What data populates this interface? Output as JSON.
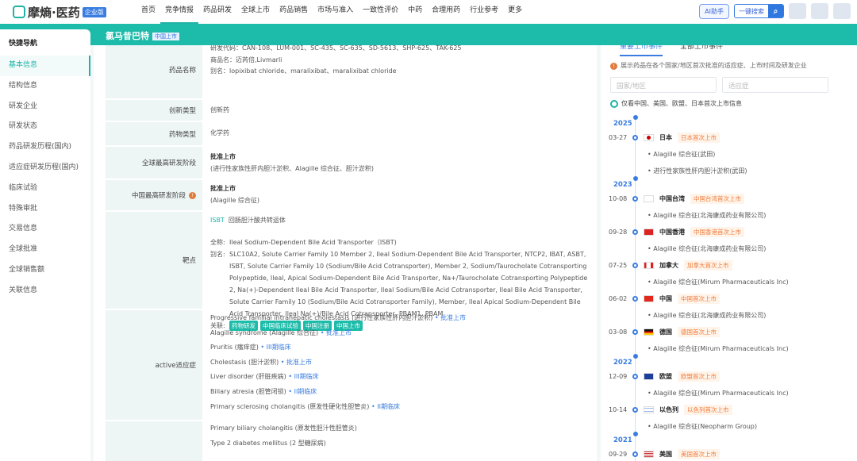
{
  "header": {
    "logo": "摩熵·医药",
    "edition": "企业版",
    "nav": [
      "首页",
      "竞争情报",
      "药品研发",
      "全球上市",
      "药品销售",
      "市场与准入",
      "一致性评价",
      "中药",
      "合理用药",
      "行业参考",
      "更多"
    ],
    "ai": "AI助手",
    "search": "一键搜索"
  },
  "drug": {
    "name": "氯马昔巴特",
    "tag": "中国上市"
  },
  "sidebar": {
    "title": "快捷导航",
    "items": [
      "基本信息",
      "结构信息",
      "研发企业",
      "研发状态",
      "药品研发历程(国内)",
      "适应症研发历程(国内)",
      "临床试验",
      "特殊审批",
      "交易信息",
      "全球批准",
      "全球销售额",
      "关联信息"
    ]
  },
  "info": {
    "name_label": "药品名称",
    "codes": "研发代码：CAN-108、LUM-001、SC-435、SC-635、SD-5613、SHP-625、TAK-625",
    "trade": "商品名：迈芮倍,Livmarli",
    "alias": "别名：lopixibat chloride、maralixibat、maralixibat chloride",
    "innov_label": "创新类型",
    "innov": "创新药",
    "type_label": "药物类型",
    "type": "化学药",
    "global_label": "全球最高研发阶段",
    "global_stage": "批准上市",
    "global_note": "(进行性家族性肝内胆汁淤积、Alagille 综合征、胆汁淤积)",
    "china_label": "中国最高研发阶段",
    "china_stage": "批准上市",
    "china_note": "(Alagille 综合征)",
    "target_label": "靶点",
    "target_code": "ISBT",
    "target_cn": "回肠胆汁酸共转运体",
    "full_label": "全称:",
    "full": "Ileal Sodium-Dependent Bile Acid Transporter（ISBT)",
    "alias_label": "别名:",
    "target_alias": "SLC10A2, Solute Carrier Family 10 Member 2, Ileal Sodium-Dependent Bile Acid Transporter, NTCP2, IBAT, ASBT, ISBT, Solute Carrier Family 10 (Sodium/Bile Acid Cotransporter), Member 2, Sodium/Taurocholate Cotransporting Polypeptide, Ileal, Apical Sodium-Dependent Bile Acid Transporter, Na+/Taurocholate Cotransporting Polypeptide 2, Na(+)-Dependent Ileal Bile Acid Transporter, Ileal Sodium/Bile Acid Cotransporter, Ileal Bile Acid Transporter, Solute Carrier Family 10 (Sodium/Bile Acid Cotransporter Family), Member, Ileal Apical Sodium-Dependent Bile Acid Transporter, Ileal Na(+)/Bile Acid Cotransporter, PBAM1, PBAM",
    "rel_label": "关联:",
    "rel": [
      "药物研发",
      "中国临床试验",
      "中国注册",
      "中国上市"
    ],
    "active_label": "active适应症",
    "active": [
      {
        "n": "Progressive familial intrahepatic cholestasis (进行性家族性肝内胆汁淤积)",
        "s": "• 批准上市"
      },
      {
        "n": "Alagille syndrome (Alagille 综合征)",
        "s": "• 批准上市"
      },
      {
        "n": "Pruritis (瘙痒症)",
        "s": "• III期临床"
      },
      {
        "n": "Cholestasis (胆汁淤积)",
        "s": "• 批准上市"
      },
      {
        "n": "Liver disorder (肝脏疾病)",
        "s": "• III期临床"
      },
      {
        "n": "Biliary atresia (胆管闭锁)",
        "s": "• II期临床"
      },
      {
        "n": "Primary sclerosing cholangitis (原发性硬化性胆管炎)",
        "s": "• II期临床"
      }
    ],
    "next": [
      "Primary biliary cholangitis (原发性胆汁性胆管炎)",
      "Type 2 diabetes mellitus (2 型糖尿病)"
    ]
  },
  "right": {
    "tabs": [
      "重要上市事件",
      "全部上市事件"
    ],
    "tip": "展示药品在各个国家/地区首次批准的适应症、上市时间及研发企业",
    "country_ph": "国家/地区",
    "ind_ph": "适应症",
    "filter": "仅看中国、美国、欧盟、日本首次上市信息",
    "timeline": [
      {
        "year": "2025",
        "events": [
          {
            "date": "03-27",
            "country": "日本",
            "tag": "日本首次上市",
            "flag": "jp",
            "items": [
              "Alagille 综合征(武田)",
              "进行性家族性肝内胆汁淤积(武田)"
            ]
          }
        ]
      },
      {
        "year": "2023",
        "events": [
          {
            "date": "10-08",
            "country": "中国台湾",
            "tag": "中国台湾首次上市",
            "flag": "tw",
            "items": [
              "Alagille 综合征(北海康成药业有限公司)"
            ]
          },
          {
            "date": "09-28",
            "country": "中国香港",
            "tag": "中国香港首次上市",
            "flag": "hk",
            "items": [
              "Alagille 综合征(北海康成药业有限公司)"
            ]
          },
          {
            "date": "07-25",
            "country": "加拿大",
            "tag": "加拿大首次上市",
            "flag": "ca",
            "items": [
              "Alagille 综合征(Mirum Pharmaceuticals Inc)"
            ]
          },
          {
            "date": "06-02",
            "country": "中国",
            "tag": "中国首次上市",
            "flag": "cn",
            "items": [
              "Alagille 综合征(北海康成药业有限公司)"
            ]
          },
          {
            "date": "03-08",
            "country": "德国",
            "tag": "德国首次上市",
            "flag": "de",
            "items": [
              "Alagille 综合征(Mirum Pharmaceuticals Inc)"
            ]
          }
        ]
      },
      {
        "year": "2022",
        "events": [
          {
            "date": "12-09",
            "country": "欧盟",
            "tag": "欧盟首次上市",
            "flag": "eu",
            "items": [
              "Alagille 综合征(Mirum Pharmaceuticals Inc)"
            ]
          },
          {
            "date": "10-14",
            "country": "以色列",
            "tag": "以色列首次上市",
            "flag": "il",
            "items": [
              "Alagille 综合征(Neopharm Group)"
            ]
          }
        ]
      },
      {
        "year": "2021",
        "events": [
          {
            "date": "09-29",
            "country": "美国",
            "tag": "美国首次上市",
            "flag": "us",
            "items": []
          }
        ]
      }
    ]
  }
}
